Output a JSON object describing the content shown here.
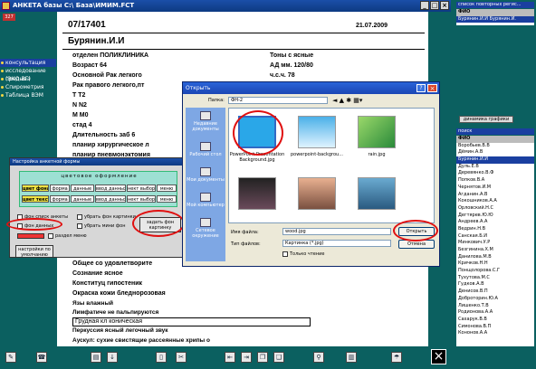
{
  "app": {
    "title": "АНКЕТА базы С:\\ База\\ИМИМ.FCT",
    "badge": "327"
  },
  "left_menu": [
    {
      "label": "консультация",
      "selected": true
    },
    {
      "label": "исследование (ЭКО-ВГ)",
      "selected": false
    },
    {
      "label": "предыва",
      "selected": false
    },
    {
      "label": "Спирометрия",
      "selected": false
    },
    {
      "label": "Таблица ВЭМ",
      "selected": false
    }
  ],
  "doc": {
    "number": "07/17401",
    "date": "21.07.2009",
    "name": "Бурянин.И.И",
    "lines": [
      "отделен ПОЛИКЛИНИКА",
      "Возраст 64",
      "Основной Рак легкого",
      "Рак правого легкого,пт",
      "Т Т2",
      "N N2",
      "M M0",
      "стад 4",
      "Длительность заб 6",
      "планир хирургическое л",
      "планир пневмонэктомия"
    ],
    "right_lines": [
      "Тоны с ясные",
      "АД мм. 120/80",
      "ч.с.ч. 78"
    ],
    "body_lines": [
      "Общее со удовлетворите",
      "Сознание ясное",
      "Конституц гипостеник",
      "Окраска кожи бледнорозовая",
      "Язы влажный",
      "Лимфатиче не пальпируются",
      "Грудная кл коническая",
      "Перкуссия ясный легочный звук",
      "Аускул: сухие свистящие рассеянные хрипы о"
    ]
  },
  "cfg": {
    "title": "Настройка анкетной формы",
    "heading": "цветовое оформление",
    "row1_label": "цвет фона",
    "row2_label": "цвет текста",
    "cells": [
      "форма",
      "данные",
      "ввод данных",
      "нект выбор",
      "меню"
    ],
    "checks": [
      "фон списк анкеты",
      "убрать фон картинки",
      "фон данных",
      "убрать мини фон",
      "раздел меню"
    ],
    "set_bg": "задать фон картинку",
    "default": "настройки по умолчанию"
  },
  "dialog": {
    "title": "Открыть",
    "folder_label": "Папка:",
    "folder": "ФН-2",
    "places": [
      "Недавние документы",
      "Рабочий стол",
      "Мои документы",
      "Мой компьютер",
      "Сетевое окружение"
    ],
    "files": [
      {
        "name": "PowerPoint Presentation Background.jpg",
        "color": "#2aa7e8"
      },
      {
        "name": "powerpoint-backgrou...",
        "color": "#5ab4e0"
      },
      {
        "name": "rain.jpg",
        "color": "#52b04a"
      },
      {
        "name": "",
        "color": "#3a2a3a"
      },
      {
        "name": "",
        "color": "#cc8866"
      },
      {
        "name": "",
        "color": "#4a8ab0"
      }
    ],
    "filename_label": "Имя файла:",
    "filename": "wood.jpg",
    "filetype_label": "Тип файлов:",
    "filetype": "Картинка (*.jpg)",
    "readonly": "Только чтение",
    "open": "Открыть",
    "cancel": "Отмена"
  },
  "right_panel": {
    "head1": "список повторных регис...",
    "list1": [
      "ФИО",
      "Бурянин.И.И"
    ],
    "list1_right": "Бурянин.И.",
    "dyn_button": "динамика графики",
    "head2": "поиск",
    "list2": [
      "ФИО",
      "Воробьев.В.В",
      "Дёмин.А.В",
      "Бурянин.И.И",
      "Дуль.Е.В",
      "Деревянко.В.Ф",
      "Попков.В.А",
      "Чернятов.И.М",
      "Агданин.А.В",
      "Кокошников.А.А",
      "Орловский.Н.С",
      "Дегтярев.Ю.Ю",
      "Андреев.А.А",
      "Ведрин.Н.В",
      "Санская.Б.И",
      "Минкович.У.Р",
      "Безгинина.Х.М",
      "Данилова.М.В",
      "Кричков.Н.Н",
      "Понщолорова.С.Г",
      "Тухутова.М.С",
      "Гудков.А.В",
      "Денисов.В.П",
      "Доброторин.Ю.А",
      "Лишенко.Т.В",
      "Родионова.А.А",
      "Сахарук.В.В",
      "Симонова.В.П",
      "Кононов.А.А"
    ]
  },
  "colors": {
    "accent": "#1a3fa0",
    "bg": "#0b6060",
    "highlight": "#e01010"
  }
}
